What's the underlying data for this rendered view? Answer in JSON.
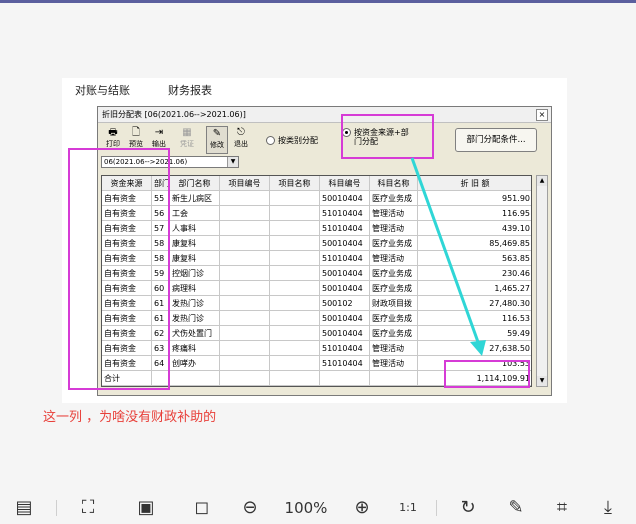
{
  "menu": {
    "reconcile": "对账与结账",
    "reports": "财务报表"
  },
  "window": {
    "title": "折旧分配表 [06(2021.06-->2021.06)]",
    "close": "×"
  },
  "toolbar": [
    {
      "label": "打印",
      "icon": "printer-icon",
      "glyph": "🖶"
    },
    {
      "label": "预览",
      "icon": "preview-icon",
      "glyph": "🗋"
    },
    {
      "label": "输出",
      "icon": "export-icon",
      "glyph": "⇥"
    },
    {
      "label": "凭证",
      "icon": "voucher-icon",
      "glyph": "▦"
    },
    {
      "label": "修改",
      "icon": "edit-icon",
      "glyph": "✎"
    },
    {
      "label": "退出",
      "icon": "exit-icon",
      "glyph": "⎋"
    }
  ],
  "options": {
    "by_category": "按类别分配",
    "by_fund_line1": "按资金来源+部",
    "by_fund_line2": "门分配",
    "dept_condition": "部门分配条件..."
  },
  "period_select": "06(2021.06-->2021.06)",
  "table": {
    "headers": [
      "资金来源",
      "部门编号",
      "部门名称",
      "项目编号",
      "项目名称",
      "科目编号",
      "科目名称",
      "折  旧  额"
    ],
    "rows": [
      [
        "自有资金",
        "55",
        "新生儿病区",
        "",
        "",
        "50010404",
        "医疗业务成",
        "951.90"
      ],
      [
        "自有资金",
        "56",
        "工会",
        "",
        "",
        "51010404",
        "管理活动",
        "116.95"
      ],
      [
        "自有资金",
        "57",
        "人事科",
        "",
        "",
        "51010404",
        "管理活动",
        "439.10"
      ],
      [
        "自有资金",
        "58",
        "康复科",
        "",
        "",
        "50010404",
        "医疗业务成",
        "85,469.85"
      ],
      [
        "自有资金",
        "58",
        "康复科",
        "",
        "",
        "51010404",
        "管理活动",
        "563.85"
      ],
      [
        "自有资金",
        "59",
        "控烟门诊",
        "",
        "",
        "50010404",
        "医疗业务成",
        "230.46"
      ],
      [
        "自有资金",
        "60",
        "病理科",
        "",
        "",
        "50010404",
        "医疗业务成",
        "1,465.27"
      ],
      [
        "自有资金",
        "61",
        "发热门诊",
        "",
        "",
        "500102",
        "财政项目拨",
        "27,480.30"
      ],
      [
        "自有资金",
        "61",
        "发热门诊",
        "",
        "",
        "50010404",
        "医疗业务成",
        "116.53"
      ],
      [
        "自有资金",
        "62",
        "犬伤处置门",
        "",
        "",
        "50010404",
        "医疗业务成",
        "59.49"
      ],
      [
        "自有资金",
        "63",
        "疼痛科",
        "",
        "",
        "51010404",
        "管理活动",
        "27,638.50"
      ],
      [
        "自有资金",
        "64",
        "创哮办",
        "",
        "",
        "51010404",
        "管理活动",
        "103.53"
      ]
    ],
    "total_label": "合计",
    "total_value": "1,114,109.91"
  },
  "annotation": "这一列 ，为啥没有财政补助的",
  "bottom_toolbar": {
    "zoom": "100%",
    "ratio": "1:1"
  },
  "colors": {
    "highlight": "#d63bd6",
    "arrow": "#2fd6d6",
    "annotation": "#e8403a"
  }
}
